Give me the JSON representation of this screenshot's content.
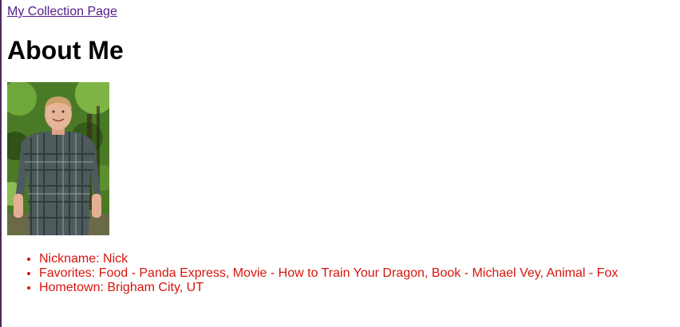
{
  "nav": {
    "collection_link": "My Collection Page"
  },
  "main": {
    "title": "About Me",
    "photo_alt": "Nick",
    "facts": [
      "Nickname: Nick",
      "Favorites: Food - Panda Express, Movie - How to Train Your Dragon, Book - Michael Vey, Animal - Fox",
      "Hometown: Brigham City, UT"
    ]
  },
  "colors": {
    "link_visited": "#551a8b",
    "list_text": "#d7140c",
    "heading": "#000000",
    "background": "#ffffff"
  }
}
